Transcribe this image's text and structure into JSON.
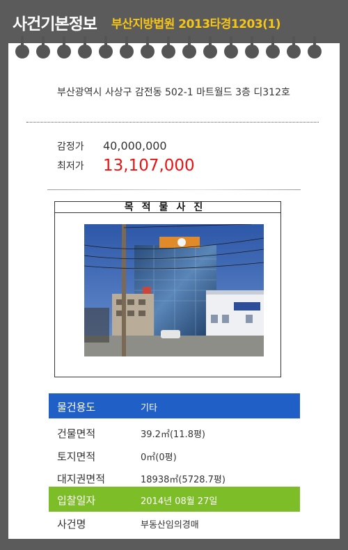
{
  "header": {
    "title": "사건기본정보",
    "case_number": "부산지방법원 2013타경1203(1)"
  },
  "property": {
    "address": "부산광역시 사상구 감전동 502-1 마트월드 3층 디312호"
  },
  "prices": {
    "appraisal_label": "감정가",
    "appraisal_value": "40,000,000",
    "minimum_label": "최저가",
    "minimum_value": "13,107,000"
  },
  "photo": {
    "title": "목적물사진"
  },
  "details": [
    {
      "label": "물건용도",
      "value": "기타"
    },
    {
      "label": "건물면적",
      "value": "39.2㎡(11.8평)"
    },
    {
      "label": "토지면적",
      "value": "0㎡(0평)"
    },
    {
      "label": "대지권면적",
      "value": "18938㎡(5728.7평)"
    },
    {
      "label": "입찰일자",
      "value": "2014년 08월 27일"
    },
    {
      "label": "사건명",
      "value": "부동산임의경매"
    }
  ],
  "colors": {
    "case_number": "#f5c518",
    "minimum_price": "#ee1111",
    "usage_row": "#1f5fc6",
    "bid_date_row": "#7dbd28"
  }
}
